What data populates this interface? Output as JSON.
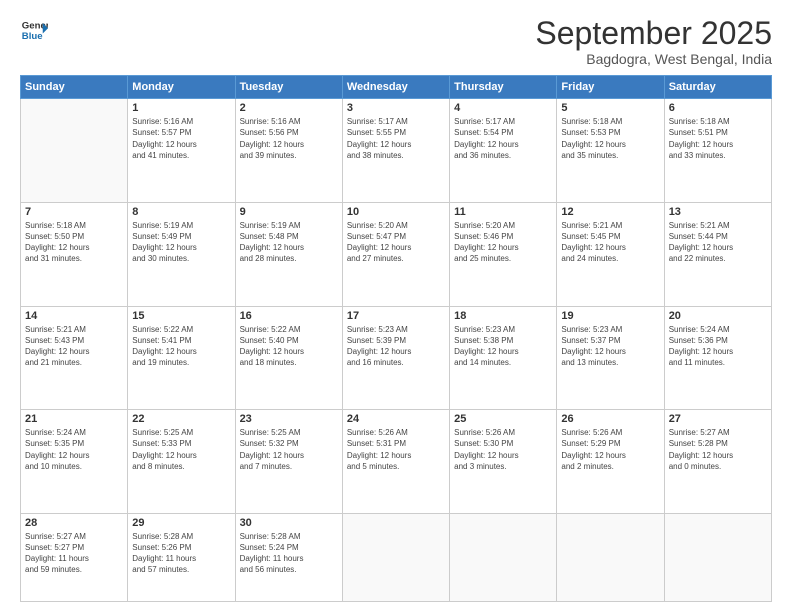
{
  "logo": {
    "line1": "General",
    "line2": "Blue"
  },
  "title": "September 2025",
  "location": "Bagdogra, West Bengal, India",
  "days_header": [
    "Sunday",
    "Monday",
    "Tuesday",
    "Wednesday",
    "Thursday",
    "Friday",
    "Saturday"
  ],
  "weeks": [
    [
      {
        "day": "",
        "info": ""
      },
      {
        "day": "1",
        "info": "Sunrise: 5:16 AM\nSunset: 5:57 PM\nDaylight: 12 hours\nand 41 minutes."
      },
      {
        "day": "2",
        "info": "Sunrise: 5:16 AM\nSunset: 5:56 PM\nDaylight: 12 hours\nand 39 minutes."
      },
      {
        "day": "3",
        "info": "Sunrise: 5:17 AM\nSunset: 5:55 PM\nDaylight: 12 hours\nand 38 minutes."
      },
      {
        "day": "4",
        "info": "Sunrise: 5:17 AM\nSunset: 5:54 PM\nDaylight: 12 hours\nand 36 minutes."
      },
      {
        "day": "5",
        "info": "Sunrise: 5:18 AM\nSunset: 5:53 PM\nDaylight: 12 hours\nand 35 minutes."
      },
      {
        "day": "6",
        "info": "Sunrise: 5:18 AM\nSunset: 5:51 PM\nDaylight: 12 hours\nand 33 minutes."
      }
    ],
    [
      {
        "day": "7",
        "info": "Sunrise: 5:18 AM\nSunset: 5:50 PM\nDaylight: 12 hours\nand 31 minutes."
      },
      {
        "day": "8",
        "info": "Sunrise: 5:19 AM\nSunset: 5:49 PM\nDaylight: 12 hours\nand 30 minutes."
      },
      {
        "day": "9",
        "info": "Sunrise: 5:19 AM\nSunset: 5:48 PM\nDaylight: 12 hours\nand 28 minutes."
      },
      {
        "day": "10",
        "info": "Sunrise: 5:20 AM\nSunset: 5:47 PM\nDaylight: 12 hours\nand 27 minutes."
      },
      {
        "day": "11",
        "info": "Sunrise: 5:20 AM\nSunset: 5:46 PM\nDaylight: 12 hours\nand 25 minutes."
      },
      {
        "day": "12",
        "info": "Sunrise: 5:21 AM\nSunset: 5:45 PM\nDaylight: 12 hours\nand 24 minutes."
      },
      {
        "day": "13",
        "info": "Sunrise: 5:21 AM\nSunset: 5:44 PM\nDaylight: 12 hours\nand 22 minutes."
      }
    ],
    [
      {
        "day": "14",
        "info": "Sunrise: 5:21 AM\nSunset: 5:43 PM\nDaylight: 12 hours\nand 21 minutes."
      },
      {
        "day": "15",
        "info": "Sunrise: 5:22 AM\nSunset: 5:41 PM\nDaylight: 12 hours\nand 19 minutes."
      },
      {
        "day": "16",
        "info": "Sunrise: 5:22 AM\nSunset: 5:40 PM\nDaylight: 12 hours\nand 18 minutes."
      },
      {
        "day": "17",
        "info": "Sunrise: 5:23 AM\nSunset: 5:39 PM\nDaylight: 12 hours\nand 16 minutes."
      },
      {
        "day": "18",
        "info": "Sunrise: 5:23 AM\nSunset: 5:38 PM\nDaylight: 12 hours\nand 14 minutes."
      },
      {
        "day": "19",
        "info": "Sunrise: 5:23 AM\nSunset: 5:37 PM\nDaylight: 12 hours\nand 13 minutes."
      },
      {
        "day": "20",
        "info": "Sunrise: 5:24 AM\nSunset: 5:36 PM\nDaylight: 12 hours\nand 11 minutes."
      }
    ],
    [
      {
        "day": "21",
        "info": "Sunrise: 5:24 AM\nSunset: 5:35 PM\nDaylight: 12 hours\nand 10 minutes."
      },
      {
        "day": "22",
        "info": "Sunrise: 5:25 AM\nSunset: 5:33 PM\nDaylight: 12 hours\nand 8 minutes."
      },
      {
        "day": "23",
        "info": "Sunrise: 5:25 AM\nSunset: 5:32 PM\nDaylight: 12 hours\nand 7 minutes."
      },
      {
        "day": "24",
        "info": "Sunrise: 5:26 AM\nSunset: 5:31 PM\nDaylight: 12 hours\nand 5 minutes."
      },
      {
        "day": "25",
        "info": "Sunrise: 5:26 AM\nSunset: 5:30 PM\nDaylight: 12 hours\nand 3 minutes."
      },
      {
        "day": "26",
        "info": "Sunrise: 5:26 AM\nSunset: 5:29 PM\nDaylight: 12 hours\nand 2 minutes."
      },
      {
        "day": "27",
        "info": "Sunrise: 5:27 AM\nSunset: 5:28 PM\nDaylight: 12 hours\nand 0 minutes."
      }
    ],
    [
      {
        "day": "28",
        "info": "Sunrise: 5:27 AM\nSunset: 5:27 PM\nDaylight: 11 hours\nand 59 minutes."
      },
      {
        "day": "29",
        "info": "Sunrise: 5:28 AM\nSunset: 5:26 PM\nDaylight: 11 hours\nand 57 minutes."
      },
      {
        "day": "30",
        "info": "Sunrise: 5:28 AM\nSunset: 5:24 PM\nDaylight: 11 hours\nand 56 minutes."
      },
      {
        "day": "",
        "info": ""
      },
      {
        "day": "",
        "info": ""
      },
      {
        "day": "",
        "info": ""
      },
      {
        "day": "",
        "info": ""
      }
    ]
  ]
}
